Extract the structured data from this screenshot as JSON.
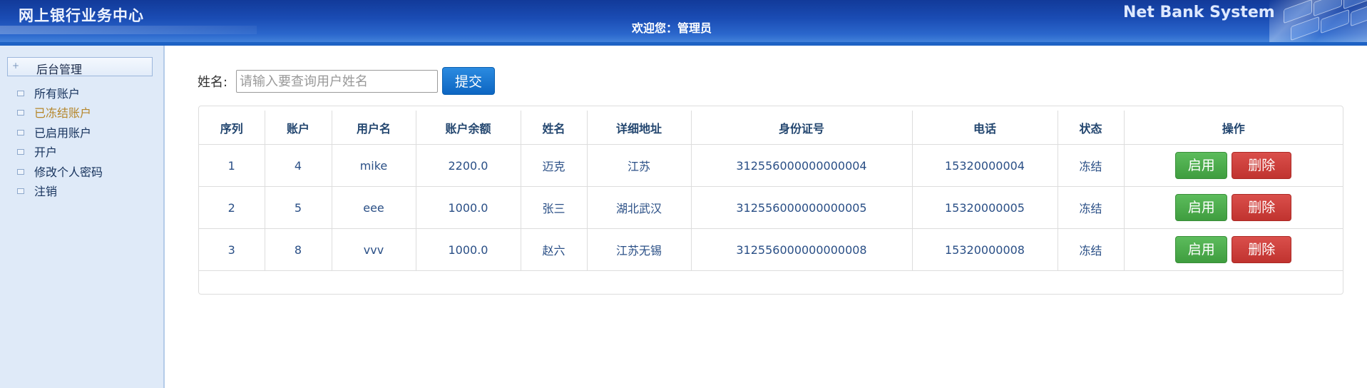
{
  "header": {
    "system_title": "网上银行业务中心",
    "welcome": "欢迎您：管理员",
    "brand": "Net Bank System"
  },
  "sidebar": {
    "head_label": "后台管理",
    "items": [
      {
        "label": "所有账户"
      },
      {
        "label": "已冻结账户"
      },
      {
        "label": "已启用账户"
      },
      {
        "label": "开户"
      },
      {
        "label": "修改个人密码"
      },
      {
        "label": "注销"
      }
    ],
    "active_color": "#b5862a"
  },
  "search": {
    "label": "姓名:",
    "placeholder": "请输入要查询用户姓名",
    "value": "",
    "submit_label": "提交"
  },
  "table": {
    "headers": [
      "序列",
      "账户",
      "用户名",
      "账户余额",
      "姓名",
      "详细地址",
      "身份证号",
      "电话",
      "状态",
      "操作"
    ],
    "rows": [
      {
        "seq": "1",
        "account": "4",
        "username": "mike",
        "balance": "2200.0",
        "name": "迈克",
        "address": "江苏",
        "id_number": "312556000000000004",
        "phone": "15320000004",
        "status": "冻结"
      },
      {
        "seq": "2",
        "account": "5",
        "username": "eee",
        "balance": "1000.0",
        "name": "张三",
        "address": "湖北武汉",
        "id_number": "312556000000000005",
        "phone": "15320000005",
        "status": "冻结"
      },
      {
        "seq": "3",
        "account": "8",
        "username": "vvv",
        "balance": "1000.0",
        "name": "赵六",
        "address": "江苏无锡",
        "id_number": "312556000000000008",
        "phone": "15320000008",
        "status": "冻结"
      }
    ],
    "enable_label": "启用",
    "delete_label": "删除"
  },
  "colors": {
    "header_blue": "#1a4cb4",
    "sidebar_bg": "#dfeaf8",
    "primary_button": "#0d66c2",
    "success_button": "#3f9d3f",
    "danger_button": "#c0332f"
  },
  "icons": {
    "sidebar_head": "plus-icon",
    "sidebar_item": "tree-node-icon"
  }
}
